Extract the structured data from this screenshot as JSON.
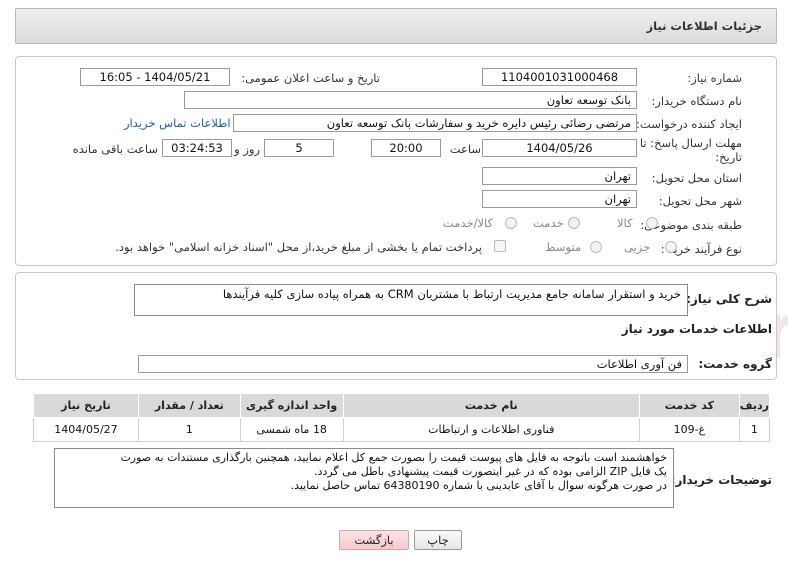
{
  "header": {
    "title": "جزئیات اطلاعات نیاز"
  },
  "fields": {
    "need_number_label": "شماره نیاز:",
    "need_number": "1104001031000468",
    "announce_label": "تاریخ و ساعت اعلان عمومی:",
    "announce_value": "1404/05/21 - 16:05",
    "buyer_org_label": "نام دستگاه خریدار:",
    "buyer_org": "بانک توسعه تعاون",
    "requester_label": "ایجاد کننده درخواست:",
    "requester": "مرتضی رضائی رئیس دایره خرید و سفارشات بانک توسعه تعاون",
    "contact_link": "اطلاعات تماس خریدار",
    "deadline_label_line1": "مهلت ارسال پاسخ: تا",
    "deadline_label_line2": "تاریخ:",
    "deadline_date": "1404/05/26",
    "time_label": "ساعت",
    "deadline_time": "20:00",
    "days_value": "5",
    "days_label": "روز و",
    "remaining_time": "03:24:53",
    "remaining_label": "ساعت باقی مانده",
    "province_label": "استان محل تحویل:",
    "province": "تهران",
    "city_label": "شهر محل تحویل:",
    "city": "تهران",
    "category_label": "طبقه بندی موضوعی:",
    "category_options": [
      "کالا",
      "خدمت",
      "کالا/خدمت"
    ],
    "process_label": "نوع فرآیند خرید :",
    "process_options": [
      "جزیی",
      "متوسط"
    ],
    "payment_note": "پرداخت تمام یا بخشی از مبلغ خرید،از محل \"اسناد خزانه اسلامی\" خواهد بود."
  },
  "description": {
    "label": "شرح کلی نیاز:",
    "value": "خرید و استقرار سامانه جامع مدیریت ارتباط با مشتریان CRM به همراه پیاده سازی کلیه فرآیندها"
  },
  "services": {
    "section_title": "اطلاعات خدمات مورد نیاز",
    "group_label": "گروه خدمت:",
    "group_value": "فن آوری اطلاعات",
    "columns": [
      "ردیف",
      "کد خدمت",
      "نام خدمت",
      "واحد اندازه گیری",
      "تعداد / مقدار",
      "تاریخ نیاز"
    ],
    "rows": [
      [
        "1",
        "غ-109",
        "فناوری اطلاعات و ارتباطات",
        "18 ماه شمسی",
        "1",
        "1404/05/27"
      ]
    ]
  },
  "buyer_notes": {
    "label": "توضیحات خریدار:",
    "lines": [
      "خواهشمند است باتوجه به فایل های پیوست قیمت را بصورت جمع کل اعلام نمایید، همچنین بارگذاری مستندات به صورت",
      "یک فایل ZIP الزامی بوده که در غیر اینصورت قیمت پیشنهادی باطل می گردد.",
      "در صورت هرگونه سوال با آقای عابدینی با شماره 64380190 تماس حاصل نمایید."
    ]
  },
  "buttons": {
    "print": "چاپ",
    "back": "بازگشت"
  },
  "watermark": {
    "text": "AriaTender.net"
  }
}
